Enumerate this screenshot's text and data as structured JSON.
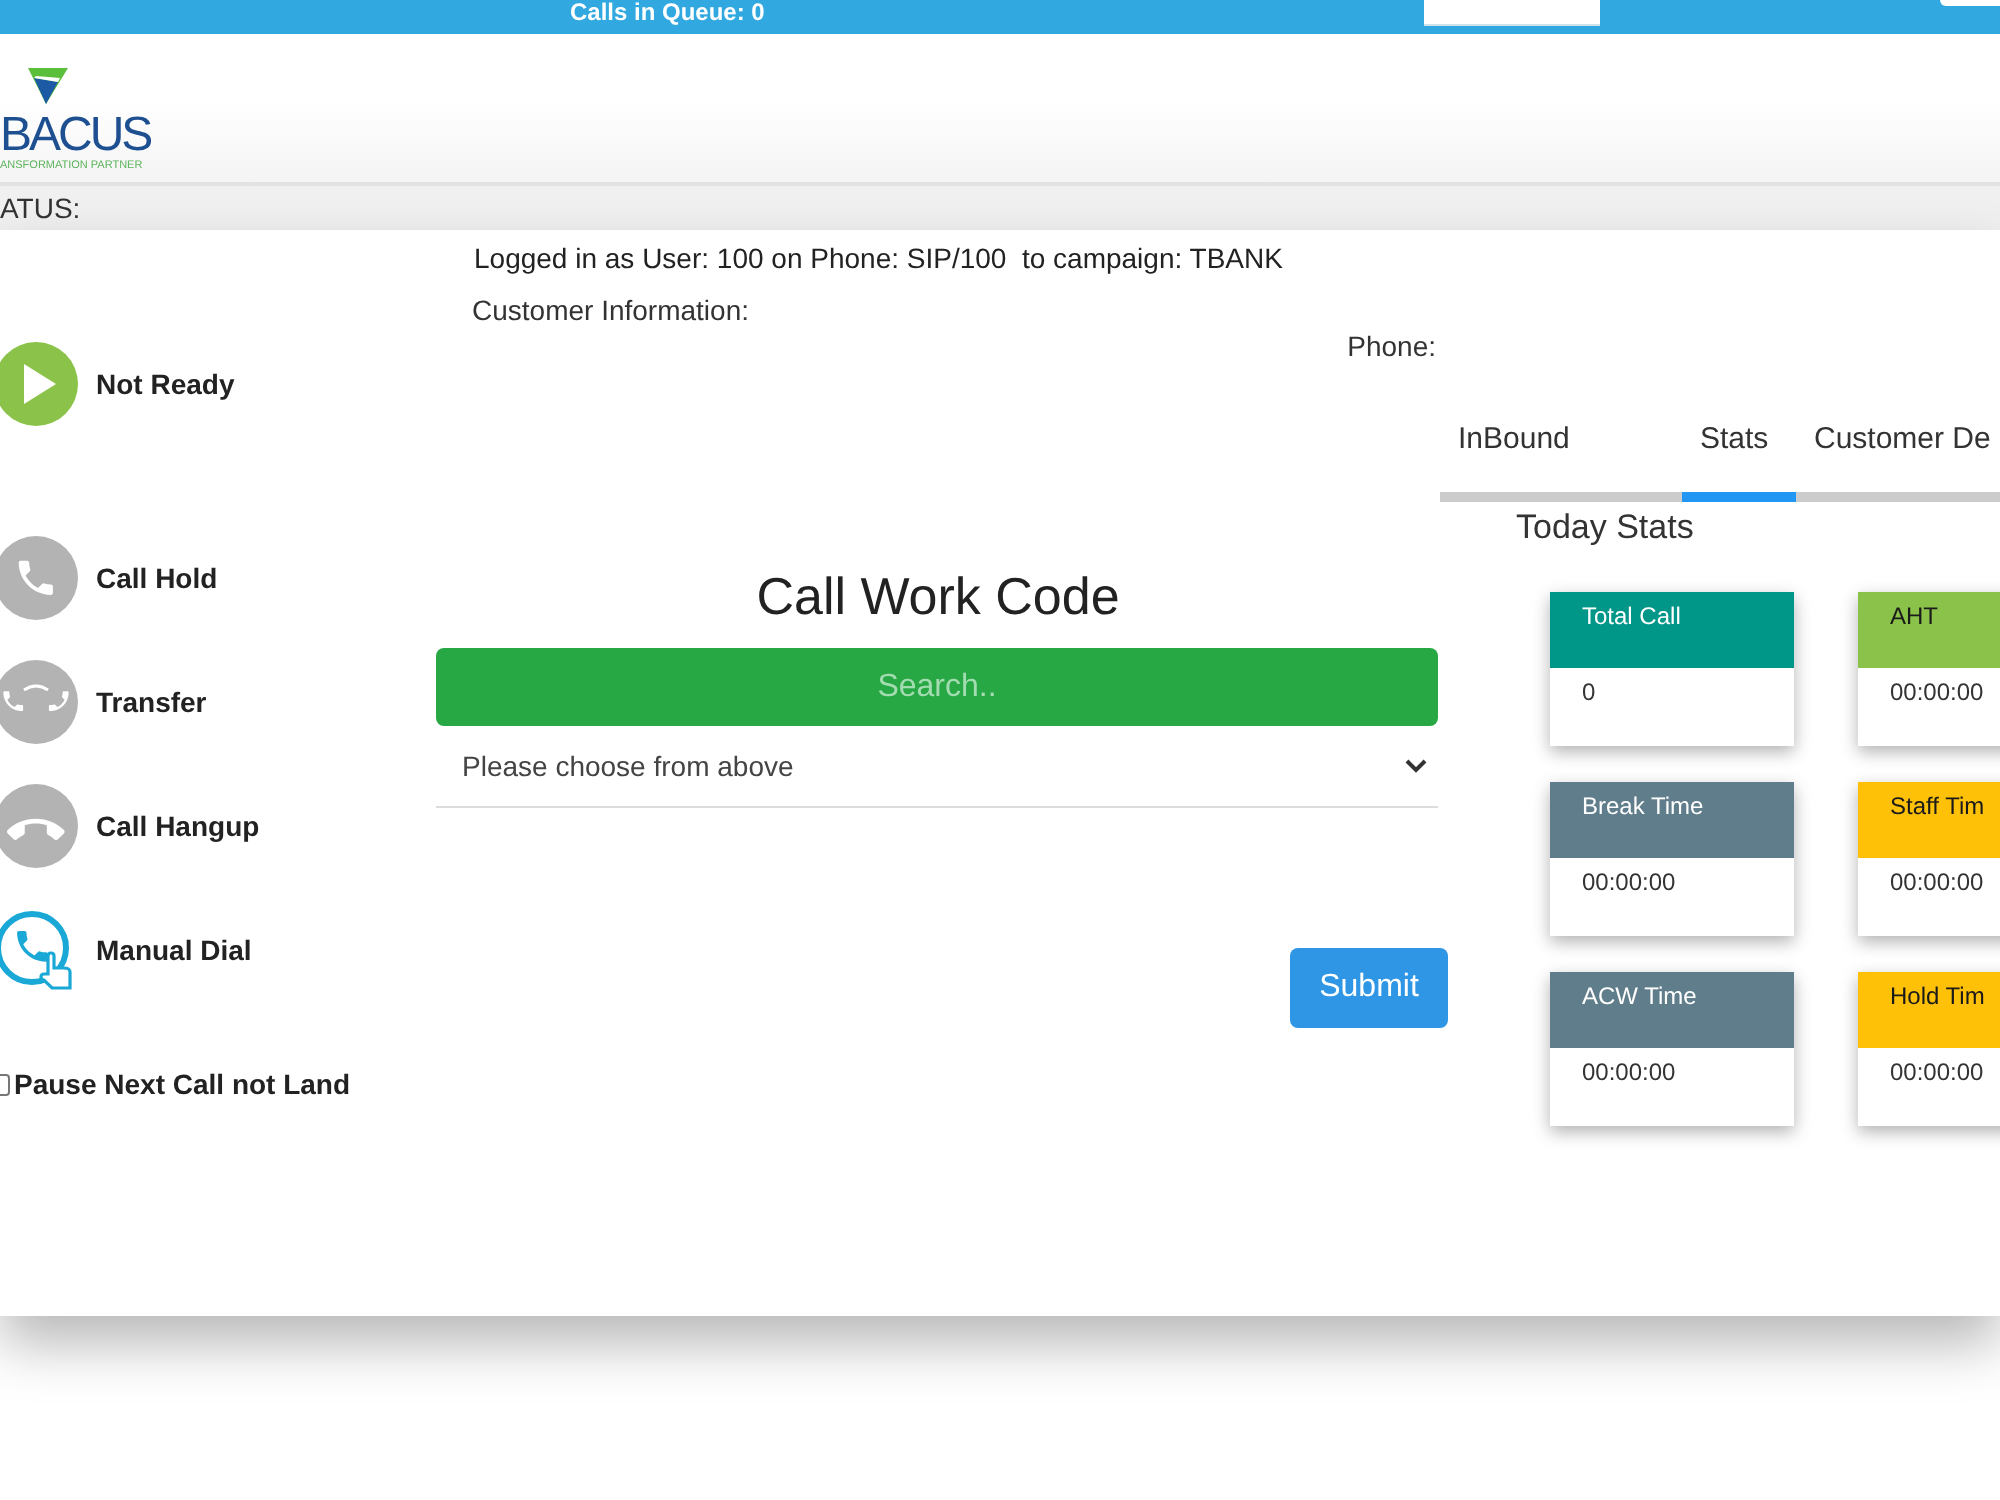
{
  "top_bar": {
    "queue_label": "Calls in Queue: 0"
  },
  "logo": {
    "name": "BACUS",
    "tagline": "ANSFORMATION PARTNER"
  },
  "status_bar": {
    "label": "ATUS:"
  },
  "actions": [
    {
      "kind": "ready",
      "label": "Not Ready",
      "disabled": false
    },
    {
      "kind": "hold",
      "label": "Call Hold",
      "disabled": true
    },
    {
      "kind": "transfer",
      "label": "Transfer",
      "disabled": true
    },
    {
      "kind": "hangup",
      "label": "Call Hangup",
      "disabled": true
    },
    {
      "kind": "dial",
      "label": "Manual Dial",
      "disabled": false
    }
  ],
  "pause_option": {
    "label": "Pause Next Call not Land",
    "checked": false
  },
  "session": {
    "login_info": "Logged in as User: 100 on Phone: SIP/100  to campaign: TBANK",
    "customer_info_label": "Customer Information:",
    "phone_label": "Phone:"
  },
  "work_code": {
    "title": "Call Work Code",
    "search": {
      "placeholder": "Search.."
    },
    "select": {
      "placeholder": "Please choose from above"
    },
    "submit": "Submit"
  },
  "tabs": [
    {
      "label": "InBound",
      "selected": false
    },
    {
      "label": "Stats",
      "selected": true
    },
    {
      "label": "Customer De",
      "selected": false
    }
  ],
  "stats": {
    "title": "Today Stats",
    "cards": [
      {
        "title": "Total Call",
        "value": "0",
        "color": "#009688"
      },
      {
        "title": "AHT",
        "value": "00:00:00",
        "color": "#8bc34a"
      },
      {
        "title": "Break Time",
        "value": "00:00:00",
        "color": "#607d8b"
      },
      {
        "title": "Staff Tim",
        "value": "00:00:00",
        "color": "#ffc107"
      },
      {
        "title": "ACW Time",
        "value": "00:00:00",
        "color": "#607d8b"
      },
      {
        "title": "Hold Tim",
        "value": "00:00:00",
        "color": "#ffc107"
      }
    ]
  }
}
